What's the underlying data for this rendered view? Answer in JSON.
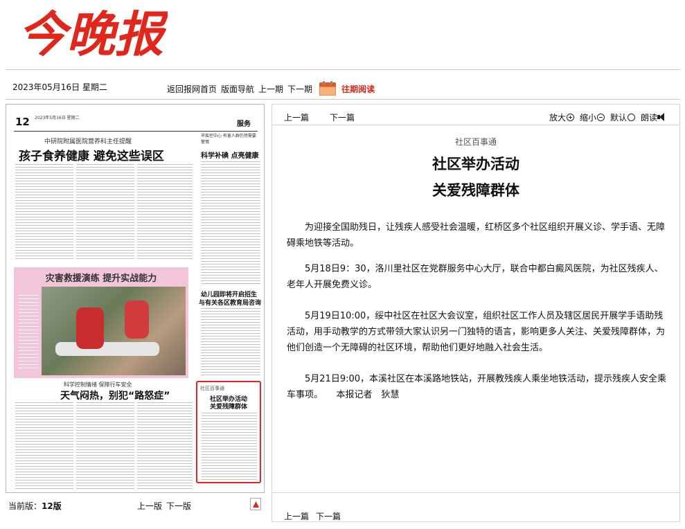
{
  "header": {
    "logo_text": "今晚报"
  },
  "topbar": {
    "date": "2023年05月16日 星期二",
    "home": "返回报网首页",
    "layout_nav": "版面导航",
    "prev_issue": "上一期",
    "next_issue": "下一期",
    "archive": "往期阅读"
  },
  "thumbnail": {
    "page_num": "12",
    "date_line": "2023年5月16日 星期二",
    "section": "服务",
    "kicker_main": "中研院附属医院营养科主任提醒",
    "headline_main": "孩子食养健康 避免这些误区",
    "right_kicker": "市疾控中心·有害人群仍然需要警惕",
    "right_head": "科学补碘 点亮健康",
    "pink_head": "灾害救援演练 提升实战能力",
    "kicker_weather": "科学控制情绪 保障行车安全",
    "headline_weather": "天气闷热，别犯“路怒症”",
    "right_head2_line1": "幼儿园即将开启招生",
    "right_head2_line2": "与有关各区教育局咨询",
    "highlight_tag": "社区百事通",
    "highlight_line1": "社区举办活动",
    "highlight_line2": "关爱残障群体"
  },
  "left_footer": {
    "current_label": "当前版：",
    "current_value": "12版",
    "prev_page": "上一版",
    "next_page": "下一版"
  },
  "article_toolbar": {
    "prev": "上一篇",
    "next": "下一篇",
    "zoom_in": "放大",
    "zoom_out": "缩小",
    "default": "默认",
    "read_aloud": "朗读"
  },
  "article": {
    "kicker": "社区百事通",
    "title_line1": "社区举办活动",
    "title_line2": "关爱残障群体",
    "paragraphs": [
      "为迎接全国助残日，让残疾人感受社会温暖，红桥区多个社区组织开展义诊、学手语、无障碍乘地铁等活动。",
      "5月18日9：30，洛川里社区在党群服务中心大厅，联合中都白癜风医院，为社区残疾人、老年人开展免费义诊。",
      "5月19日10:00，绥中社区在社区大会议室，组织社区工作人员及辖区居民开展学手语助残活动，用手动教学的方式带领大家认识另一门独特的语言，影响更多人关注、关爱残障群体，为他们创造一个无障碍的社区环境，帮助他们更好地融入社会生活。",
      "5月21日9:00，本溪社区在本溪路地铁站，开展教残疾人乘坐地铁活动，提示残疾人安全乘车事项。　　本报记者　狄慧"
    ]
  },
  "article_footer": {
    "prev": "上一篇",
    "next": "下一篇"
  }
}
